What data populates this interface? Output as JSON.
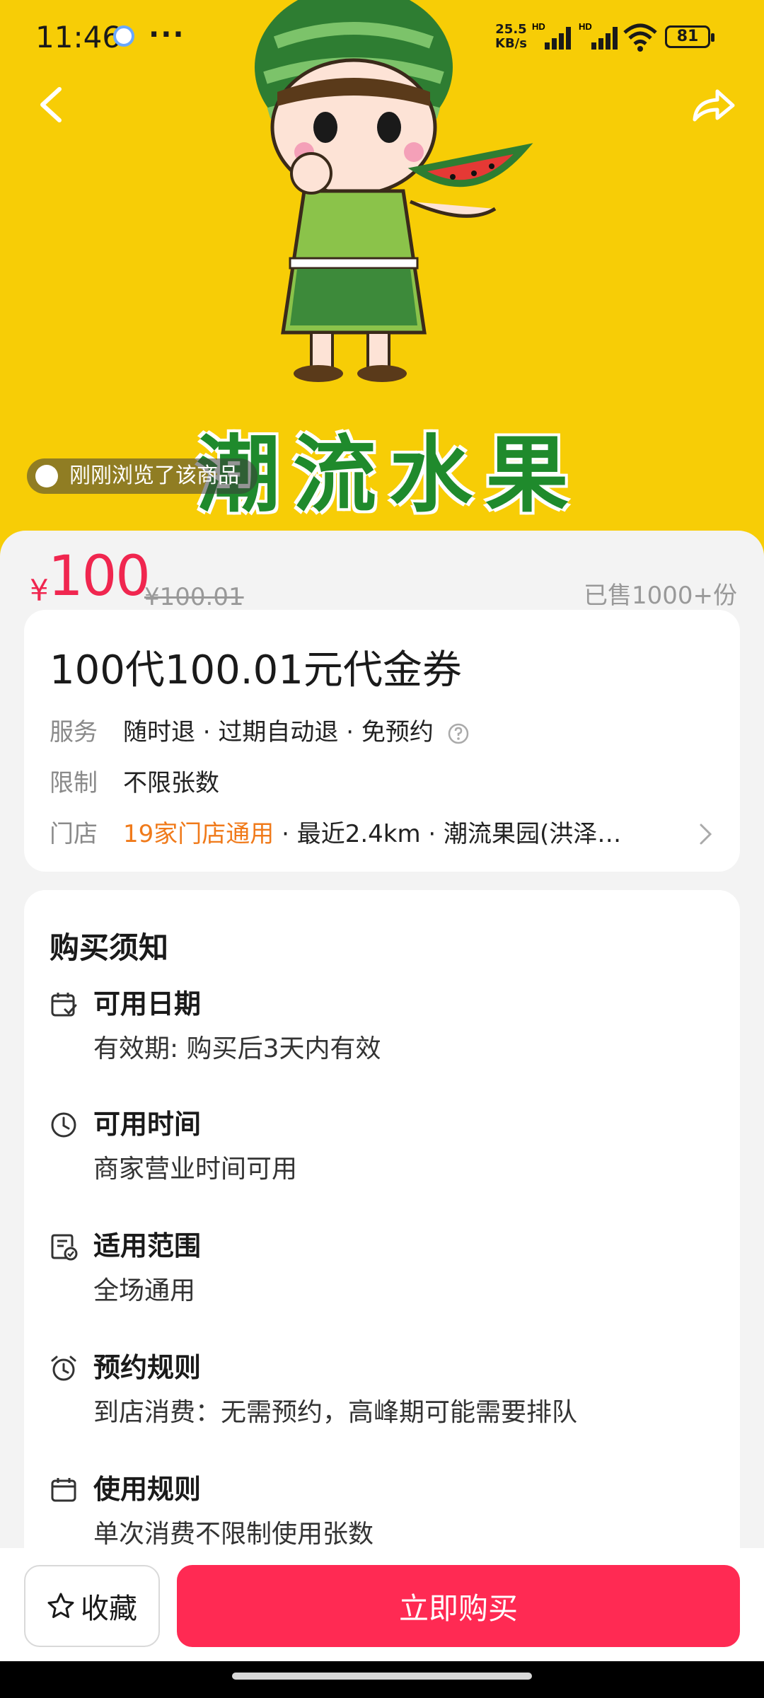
{
  "status_bar": {
    "time": "11:46",
    "more": "···",
    "net_rate": "25.5",
    "net_unit": "KB/s",
    "hd1": "HD",
    "hd2": "HD",
    "battery": "81"
  },
  "hero": {
    "brand_text": "潮流水果",
    "browse_tip": "刚刚浏览了该商品",
    "bg_color": "#f7cd06",
    "mascot": "watermelon-boy-mascot"
  },
  "price": {
    "currency": "¥",
    "value": "100",
    "original": "¥100.01",
    "sold": "已售1000+份"
  },
  "deal": {
    "title": "100代100.01元代金券",
    "service_label": "服务",
    "service_value": "随时退 · 过期自动退 · 免预约",
    "limit_label": "限制",
    "limit_value": "不限张数",
    "store_label": "门店",
    "store_highlight": "19家门店通用",
    "store_rest": " · 最近2.4km · 潮流果园(洪泽…"
  },
  "notice": {
    "title": "购买须知",
    "items": [
      {
        "icon": "calendar-check-icon",
        "heading": "可用日期",
        "detail": "有效期: 购买后3天内有效"
      },
      {
        "icon": "clock-icon",
        "heading": "可用时间",
        "detail": "商家营业时间可用"
      },
      {
        "icon": "scope-doc-icon",
        "heading": "适用范围",
        "detail": "全场通用"
      },
      {
        "icon": "alarm-icon",
        "heading": "预约规则",
        "detail": "到店消费：无需预约，高峰期可能需要排队"
      },
      {
        "icon": "calendar-icon",
        "heading": "使用规则",
        "detail": "单次消费不限制使用张数"
      }
    ]
  },
  "bottom": {
    "favorite_label": "收藏",
    "buy_label": "立即购买",
    "buy_color": "#ff2a53"
  }
}
